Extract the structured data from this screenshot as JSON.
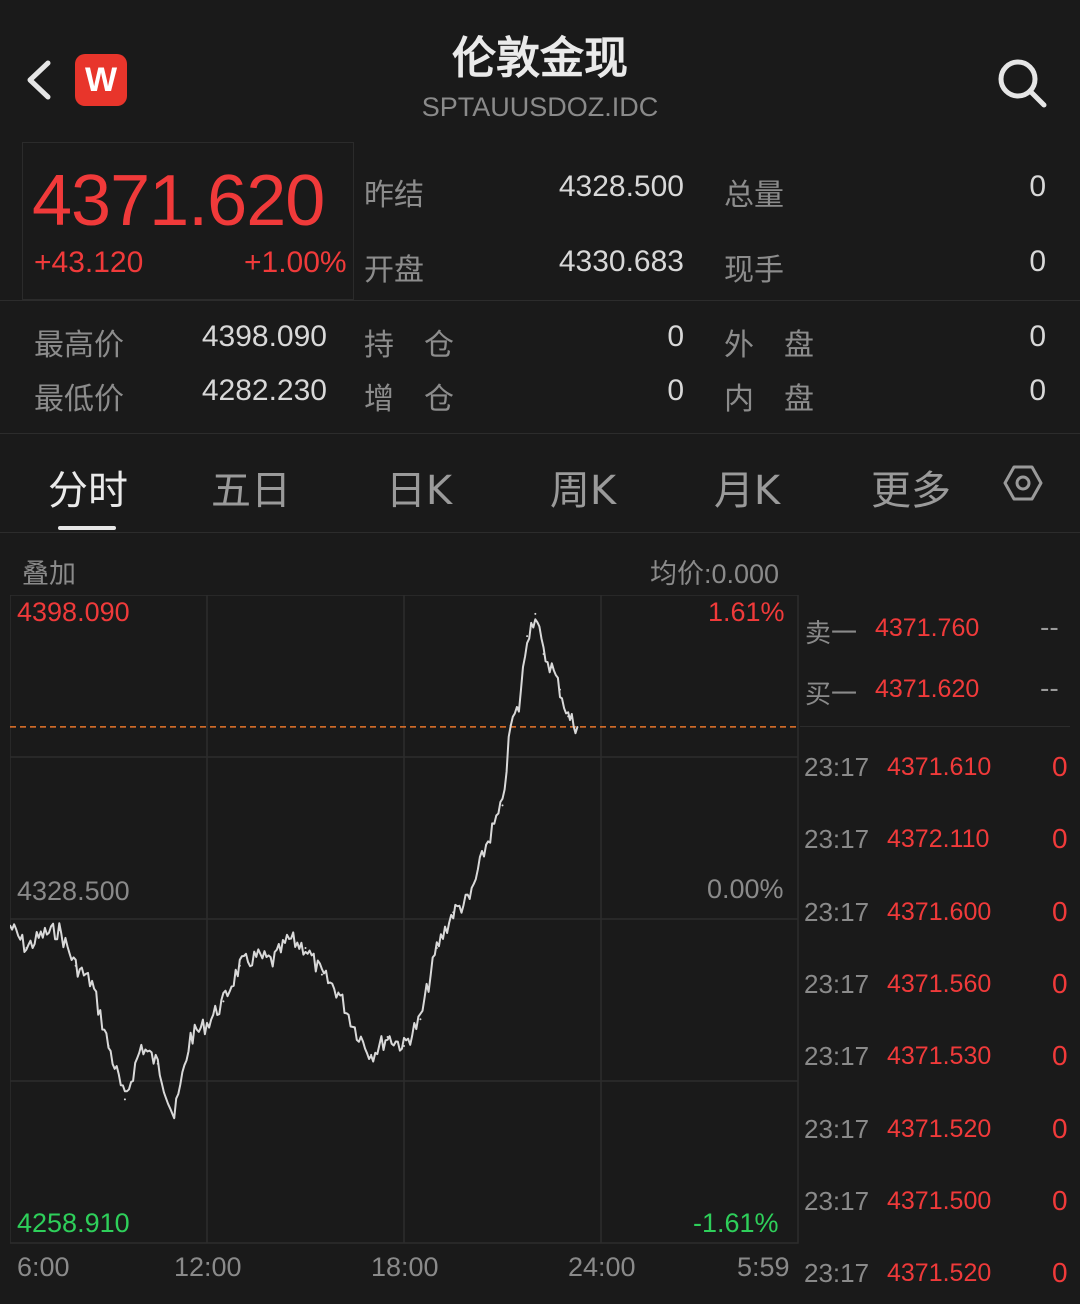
{
  "header": {
    "title": "伦敦金现",
    "subtitle": "SPTAUUSDOZ.IDC",
    "logo_letter": "W"
  },
  "quote": {
    "price": "4371.620",
    "change": "+43.120",
    "change_pct": "+1.00%",
    "fields": [
      {
        "label": "昨结",
        "value": "4328.500"
      },
      {
        "label": "总量",
        "value": "0"
      },
      {
        "label": "开盘",
        "value": "4330.683"
      },
      {
        "label": "现手",
        "value": "0"
      },
      {
        "label": "最高价",
        "value": "4398.090"
      },
      {
        "label": "持　仓",
        "value": "0"
      },
      {
        "label": "外　盘",
        "value": "0"
      },
      {
        "label": "最低价",
        "value": "4282.230"
      },
      {
        "label": "增　仓",
        "value": "0"
      },
      {
        "label": "内　盘",
        "value": "0"
      }
    ]
  },
  "tabs": [
    {
      "label": "分时",
      "active": true
    },
    {
      "label": "五日"
    },
    {
      "label": "日K"
    },
    {
      "label": "周K"
    },
    {
      "label": "月K"
    },
    {
      "label": "更多"
    }
  ],
  "chart_header": {
    "overlay_label": "叠加",
    "avg_price": "均价:0.000"
  },
  "colors": {
    "up": "#f03a3a",
    "down": "#2ecf5a",
    "line": "#d9d9d9",
    "ref": "#e8752b"
  },
  "chart_data": {
    "type": "line",
    "x_ticks": [
      "6:00",
      "12:00",
      "18:00",
      "24:00",
      "5:59"
    ],
    "y_left_ticks": [
      "4398.090",
      "4328.500",
      "4258.910"
    ],
    "y_right_ticks": [
      "1.61%",
      "0.00%",
      "-1.61%"
    ],
    "ylim": [
      4258.91,
      4398.09
    ],
    "reference_price": 4328.5,
    "last_price": 4371.62,
    "x_start_hour": 6,
    "x": [
      6.0,
      6.5,
      7.0,
      7.5,
      8.0,
      8.5,
      9.0,
      9.5,
      10.0,
      10.5,
      11.0,
      11.5,
      12.0,
      12.5,
      13.0,
      13.5,
      14.0,
      14.5,
      15.0,
      15.5,
      16.0,
      16.5,
      17.0,
      17.5,
      18.0,
      18.5,
      19.0,
      19.5,
      20.0,
      20.5,
      21.0,
      21.25,
      21.5,
      21.75,
      22.0,
      22.25,
      22.5,
      22.75,
      23.0,
      23.28
    ],
    "y": [
      4327,
      4322,
      4325,
      4326,
      4318,
      4314,
      4300,
      4288,
      4300,
      4296,
      4284,
      4302,
      4305,
      4310,
      4318,
      4320,
      4319,
      4324,
      4322,
      4316,
      4312,
      4304,
      4298,
      4302,
      4300,
      4306,
      4322,
      4330,
      4333,
      4345,
      4354,
      4372,
      4376,
      4392,
      4397,
      4388,
      4385,
      4380,
      4374,
      4371.6
    ]
  },
  "order_book": {
    "sell": {
      "label": "卖一",
      "price": "4371.760",
      "vol": "--"
    },
    "buy": {
      "label": "买一",
      "price": "4371.620",
      "vol": "--"
    }
  },
  "ticks": [
    {
      "time": "23:17",
      "price": "4371.610",
      "vol": "0"
    },
    {
      "time": "23:17",
      "price": "4372.110",
      "vol": "0"
    },
    {
      "time": "23:17",
      "price": "4371.600",
      "vol": "0"
    },
    {
      "time": "23:17",
      "price": "4371.560",
      "vol": "0"
    },
    {
      "time": "23:17",
      "price": "4371.530",
      "vol": "0"
    },
    {
      "time": "23:17",
      "price": "4371.520",
      "vol": "0"
    },
    {
      "time": "23:17",
      "price": "4371.500",
      "vol": "0"
    },
    {
      "time": "23:17",
      "price": "4371.520",
      "vol": "0"
    }
  ]
}
